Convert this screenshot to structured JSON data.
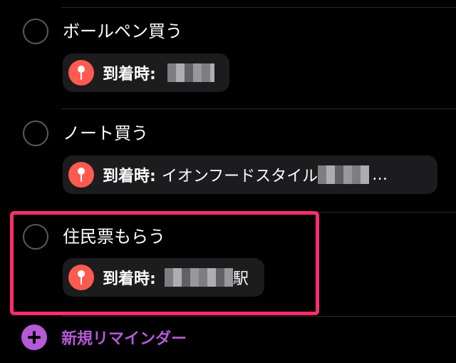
{
  "theme": {
    "background": "#000000",
    "chip_background": "#1c1c1e",
    "pin_color": "#ff5a4f",
    "accent": "#b45ad7",
    "highlight": "#ff2d6f"
  },
  "reminders": [
    {
      "title": "ボールペン買う",
      "location_label": "到着時:",
      "location_value": "",
      "location_suffix": "",
      "location_redacted": true,
      "truncated": false
    },
    {
      "title": "ノート買う",
      "location_label": "到着時:",
      "location_value": "イオンフードスタイル",
      "location_suffix": "",
      "location_redacted": true,
      "truncated": true
    },
    {
      "title": "住民票もらう",
      "location_label": "到着時:",
      "location_value": "",
      "location_suffix": "駅",
      "location_redacted": true,
      "truncated": false,
      "highlighted": true
    }
  ],
  "ellipsis": "…",
  "new_reminder": {
    "label": "新規リマインダー",
    "icon": "plus-circle-icon"
  }
}
